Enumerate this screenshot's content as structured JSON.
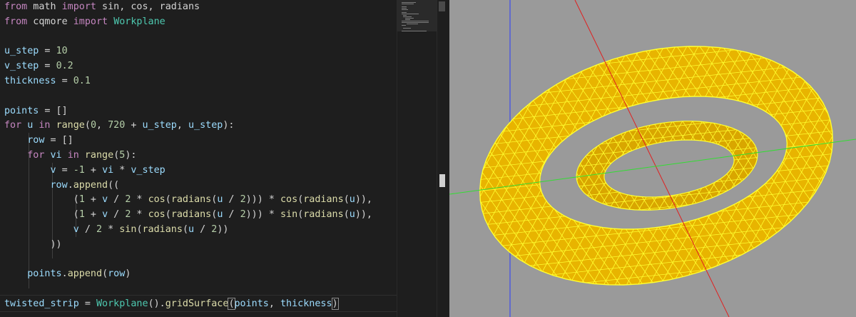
{
  "editor": {
    "lines": [
      {
        "tokens": [
          {
            "t": "from",
            "c": "kw"
          },
          {
            "t": " math ",
            "c": ""
          },
          {
            "t": "import",
            "c": "kw"
          },
          {
            "t": " sin, cos, radians",
            "c": ""
          }
        ]
      },
      {
        "tokens": [
          {
            "t": "from",
            "c": "kw"
          },
          {
            "t": " cqmore ",
            "c": ""
          },
          {
            "t": "import",
            "c": "kw"
          },
          {
            "t": " ",
            "c": ""
          },
          {
            "t": "Workplane",
            "c": "cl"
          }
        ]
      },
      {
        "tokens": []
      },
      {
        "tokens": [
          {
            "t": "u_step",
            "c": "vr"
          },
          {
            "t": " = ",
            "c": ""
          },
          {
            "t": "10",
            "c": "nm"
          }
        ]
      },
      {
        "tokens": [
          {
            "t": "v_step",
            "c": "vr"
          },
          {
            "t": " = ",
            "c": ""
          },
          {
            "t": "0.2",
            "c": "nm"
          }
        ]
      },
      {
        "tokens": [
          {
            "t": "thickness",
            "c": "vr"
          },
          {
            "t": " = ",
            "c": ""
          },
          {
            "t": "0.1",
            "c": "nm"
          }
        ]
      },
      {
        "tokens": []
      },
      {
        "tokens": [
          {
            "t": "points",
            "c": "vr"
          },
          {
            "t": " = []",
            "c": ""
          }
        ]
      },
      {
        "tokens": [
          {
            "t": "for",
            "c": "kw"
          },
          {
            "t": " ",
            "c": ""
          },
          {
            "t": "u",
            "c": "vr"
          },
          {
            "t": " ",
            "c": ""
          },
          {
            "t": "in",
            "c": "kw"
          },
          {
            "t": " ",
            "c": ""
          },
          {
            "t": "range",
            "c": "fn"
          },
          {
            "t": "(",
            "c": ""
          },
          {
            "t": "0",
            "c": "nm"
          },
          {
            "t": ", ",
            "c": ""
          },
          {
            "t": "720",
            "c": "nm"
          },
          {
            "t": " + ",
            "c": ""
          },
          {
            "t": "u_step",
            "c": "vr"
          },
          {
            "t": ", ",
            "c": ""
          },
          {
            "t": "u_step",
            "c": "vr"
          },
          {
            "t": "):",
            "c": ""
          }
        ]
      },
      {
        "tokens": [
          {
            "t": "    ",
            "c": ""
          },
          {
            "t": "row",
            "c": "vr"
          },
          {
            "t": " = []",
            "c": ""
          }
        ]
      },
      {
        "tokens": [
          {
            "t": "    ",
            "c": ""
          },
          {
            "t": "for",
            "c": "kw"
          },
          {
            "t": " ",
            "c": ""
          },
          {
            "t": "vi",
            "c": "vr"
          },
          {
            "t": " ",
            "c": ""
          },
          {
            "t": "in",
            "c": "kw"
          },
          {
            "t": " ",
            "c": ""
          },
          {
            "t": "range",
            "c": "fn"
          },
          {
            "t": "(",
            "c": ""
          },
          {
            "t": "5",
            "c": "nm"
          },
          {
            "t": "):",
            "c": ""
          }
        ]
      },
      {
        "tokens": [
          {
            "t": "        ",
            "c": ""
          },
          {
            "t": "v",
            "c": "vr"
          },
          {
            "t": " = ",
            "c": ""
          },
          {
            "t": "-1",
            "c": "nm"
          },
          {
            "t": " + ",
            "c": ""
          },
          {
            "t": "vi",
            "c": "vr"
          },
          {
            "t": " * ",
            "c": ""
          },
          {
            "t": "v_step",
            "c": "vr"
          }
        ]
      },
      {
        "tokens": [
          {
            "t": "        ",
            "c": ""
          },
          {
            "t": "row",
            "c": "vr"
          },
          {
            "t": ".",
            "c": ""
          },
          {
            "t": "append",
            "c": "fn"
          },
          {
            "t": "((",
            "c": ""
          }
        ]
      },
      {
        "tokens": [
          {
            "t": "            (",
            "c": ""
          },
          {
            "t": "1",
            "c": "nm"
          },
          {
            "t": " + ",
            "c": ""
          },
          {
            "t": "v",
            "c": "vr"
          },
          {
            "t": " / ",
            "c": ""
          },
          {
            "t": "2",
            "c": "nm"
          },
          {
            "t": " * ",
            "c": ""
          },
          {
            "t": "cos",
            "c": "fn"
          },
          {
            "t": "(",
            "c": ""
          },
          {
            "t": "radians",
            "c": "fn"
          },
          {
            "t": "(",
            "c": ""
          },
          {
            "t": "u",
            "c": "vr"
          },
          {
            "t": " / ",
            "c": ""
          },
          {
            "t": "2",
            "c": "nm"
          },
          {
            "t": "))) * ",
            "c": ""
          },
          {
            "t": "cos",
            "c": "fn"
          },
          {
            "t": "(",
            "c": ""
          },
          {
            "t": "radians",
            "c": "fn"
          },
          {
            "t": "(",
            "c": ""
          },
          {
            "t": "u",
            "c": "vr"
          },
          {
            "t": ")),",
            "c": ""
          }
        ]
      },
      {
        "tokens": [
          {
            "t": "            (",
            "c": ""
          },
          {
            "t": "1",
            "c": "nm"
          },
          {
            "t": " + ",
            "c": ""
          },
          {
            "t": "v",
            "c": "vr"
          },
          {
            "t": " / ",
            "c": ""
          },
          {
            "t": "2",
            "c": "nm"
          },
          {
            "t": " * ",
            "c": ""
          },
          {
            "t": "cos",
            "c": "fn"
          },
          {
            "t": "(",
            "c": ""
          },
          {
            "t": "radians",
            "c": "fn"
          },
          {
            "t": "(",
            "c": ""
          },
          {
            "t": "u",
            "c": "vr"
          },
          {
            "t": " / ",
            "c": ""
          },
          {
            "t": "2",
            "c": "nm"
          },
          {
            "t": "))) * ",
            "c": ""
          },
          {
            "t": "sin",
            "c": "fn"
          },
          {
            "t": "(",
            "c": ""
          },
          {
            "t": "radians",
            "c": "fn"
          },
          {
            "t": "(",
            "c": ""
          },
          {
            "t": "u",
            "c": "vr"
          },
          {
            "t": ")),",
            "c": ""
          }
        ]
      },
      {
        "tokens": [
          {
            "t": "            ",
            "c": ""
          },
          {
            "t": "v",
            "c": "vr"
          },
          {
            "t": " / ",
            "c": ""
          },
          {
            "t": "2",
            "c": "nm"
          },
          {
            "t": " * ",
            "c": ""
          },
          {
            "t": "sin",
            "c": "fn"
          },
          {
            "t": "(",
            "c": ""
          },
          {
            "t": "radians",
            "c": "fn"
          },
          {
            "t": "(",
            "c": ""
          },
          {
            "t": "u",
            "c": "vr"
          },
          {
            "t": " / ",
            "c": ""
          },
          {
            "t": "2",
            "c": "nm"
          },
          {
            "t": "))",
            "c": ""
          }
        ]
      },
      {
        "tokens": [
          {
            "t": "        ))",
            "c": ""
          }
        ]
      },
      {
        "tokens": []
      },
      {
        "tokens": [
          {
            "t": "    ",
            "c": ""
          },
          {
            "t": "points",
            "c": "vr"
          },
          {
            "t": ".",
            "c": ""
          },
          {
            "t": "append",
            "c": "fn"
          },
          {
            "t": "(",
            "c": ""
          },
          {
            "t": "row",
            "c": "vr"
          },
          {
            "t": ")",
            "c": ""
          }
        ]
      },
      {
        "tokens": []
      },
      {
        "tokens": [
          {
            "t": "twisted_strip",
            "c": "vr"
          },
          {
            "t": " = ",
            "c": ""
          },
          {
            "t": "Workplane",
            "c": "cl"
          },
          {
            "t": "().",
            "c": ""
          },
          {
            "t": "gridSurface",
            "c": "fn"
          },
          {
            "t": "(",
            "c": "bracket"
          },
          {
            "t": "points",
            "c": "vr"
          },
          {
            "t": ", ",
            "c": ""
          },
          {
            "t": "thickness",
            "c": "vr"
          },
          {
            "t": ")",
            "c": "bracket"
          }
        ]
      }
    ]
  },
  "viewer": {
    "background": "#9a9a9a",
    "surface_color": "#e8b400",
    "mesh_color": "#ffff30",
    "axis_x_color": "#e02020",
    "axis_y_color": "#33dd33",
    "axis_z_color": "#2a3cff",
    "model": "twisted-strip"
  }
}
